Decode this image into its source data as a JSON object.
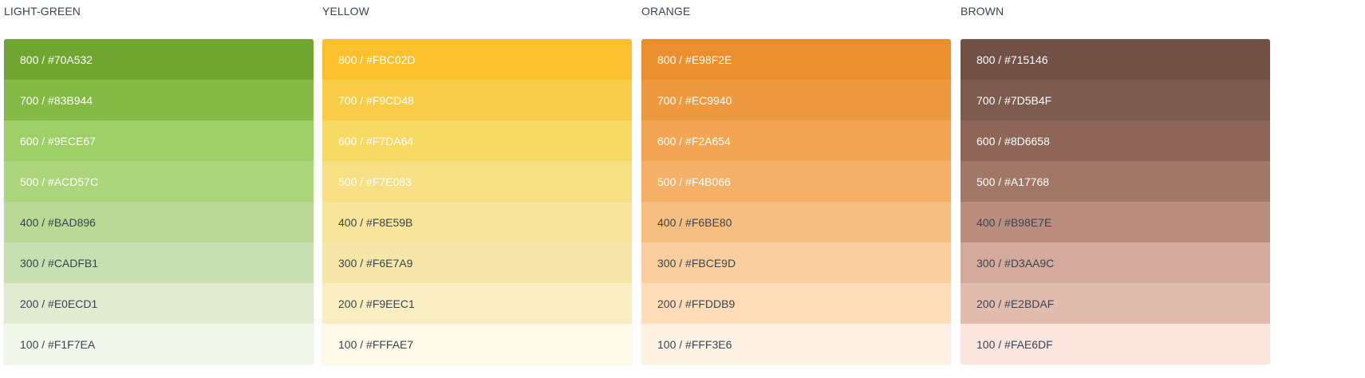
{
  "palettes": [
    {
      "name": "LIGHT-GREEN",
      "swatches": [
        {
          "label": "800 / #70A532",
          "color": "#70A532",
          "text": "#ffffff"
        },
        {
          "label": "700 / #83B944",
          "color": "#83B944",
          "text": "#ffffff"
        },
        {
          "label": "600 / #9ECE67",
          "color": "#9ECE67",
          "text": "#ffffff"
        },
        {
          "label": "500 / #ACD57C",
          "color": "#ACD57C",
          "text": "#ffffff"
        },
        {
          "label": "400 / #BAD896",
          "color": "#BAD896",
          "text": "#3a4452"
        },
        {
          "label": "300 / #CADFB1",
          "color": "#CADFB1",
          "text": "#3a4452"
        },
        {
          "label": "200 / #E0ECD1",
          "color": "#E0ECD1",
          "text": "#3a4452"
        },
        {
          "label": "100 / #F1F7EA",
          "color": "#F1F7EA",
          "text": "#3a4452"
        }
      ]
    },
    {
      "name": "YELLOW",
      "swatches": [
        {
          "label": "800 / #FBC02D",
          "color": "#FBC02D",
          "text": "#ffffff"
        },
        {
          "label": "700 / #F9CD48",
          "color": "#F9CD48",
          "text": "#ffffff"
        },
        {
          "label": "600 / #F7DA64",
          "color": "#F7DA64",
          "text": "#ffffff"
        },
        {
          "label": "500 / #F7E083",
          "color": "#F7E083",
          "text": "#ffffff"
        },
        {
          "label": "400 / #F8E59B",
          "color": "#F8E59B",
          "text": "#3a4452"
        },
        {
          "label": "300 / #F6E7A9",
          "color": "#F6E7A9",
          "text": "#3a4452"
        },
        {
          "label": "200 / #F9EEC1",
          "color": "#F9EEC1",
          "text": "#3a4452"
        },
        {
          "label": "100 / #FFFAE7",
          "color": "#FFFAE7",
          "text": "#3a4452"
        }
      ]
    },
    {
      "name": "ORANGE",
      "swatches": [
        {
          "label": "800 / #E98F2E",
          "color": "#E98F2E",
          "text": "#ffffff"
        },
        {
          "label": "700 / #EC9940",
          "color": "#EC9940",
          "text": "#ffffff"
        },
        {
          "label": "600 / #F2A654",
          "color": "#F2A654",
          "text": "#ffffff"
        },
        {
          "label": "500 / #F4B066",
          "color": "#F4B066",
          "text": "#ffffff"
        },
        {
          "label": "400 / #F6BE80",
          "color": "#F6BE80",
          "text": "#3a4452"
        },
        {
          "label": "300 / #FBCE9D",
          "color": "#FBCE9D",
          "text": "#3a4452"
        },
        {
          "label": "200 / #FFDDB9",
          "color": "#FFDDB9",
          "text": "#3a4452"
        },
        {
          "label": "100 / #FFF3E6",
          "color": "#FFF3E6",
          "text": "#3a4452"
        }
      ]
    },
    {
      "name": "BROWN",
      "swatches": [
        {
          "label": "800 / #715146",
          "color": "#715146",
          "text": "#ffffff"
        },
        {
          "label": "700 / #7D5B4F",
          "color": "#7D5B4F",
          "text": "#ffffff"
        },
        {
          "label": "600 / #8D6658",
          "color": "#8D6658",
          "text": "#ffffff"
        },
        {
          "label": "500 / #A17768",
          "color": "#A17768",
          "text": "#ffffff"
        },
        {
          "label": "400 / #B98E7E",
          "color": "#B98E7E",
          "text": "#3a4452"
        },
        {
          "label": "300 / #D3AA9C",
          "color": "#D3AA9C",
          "text": "#3a4452"
        },
        {
          "label": "200 / #E2BDAF",
          "color": "#E2BDAF",
          "text": "#3a4452"
        },
        {
          "label": "100 / #FAE6DF",
          "color": "#FAE6DF",
          "text": "#3a4452"
        }
      ]
    }
  ]
}
